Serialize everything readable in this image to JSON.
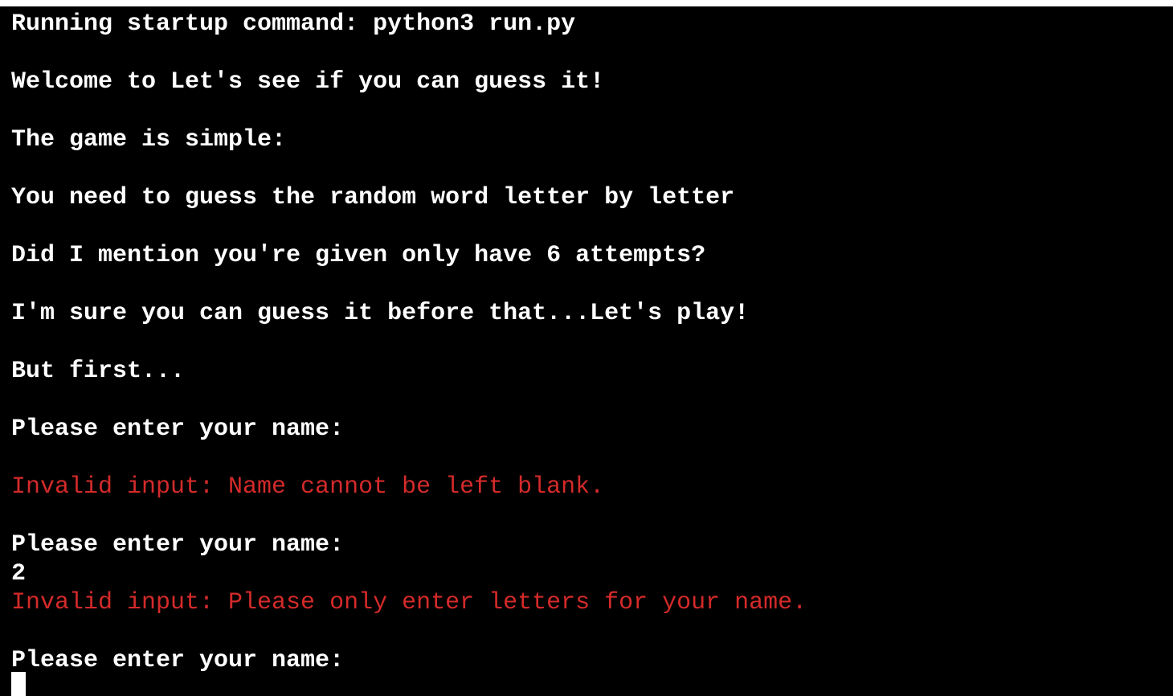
{
  "terminal": {
    "lines": {
      "startup": "Running startup command: python3 run.py",
      "welcome": "Welcome to Let's see if you can guess it!",
      "simple": "The game is simple:",
      "guess": "You need to guess the random word letter by letter",
      "attempts": "Did I mention you're given only have 6 attempts?",
      "sure": "I'm sure you can guess it before that...Let's play!",
      "first": "But first...",
      "prompt1": "Please enter your name:",
      "error1": "Invalid input: Name cannot be left blank.",
      "prompt2": "Please enter your name:",
      "input2": "2",
      "error2": "Invalid input: Please only enter letters for your name.",
      "prompt3": "Please enter your name:"
    },
    "colors": {
      "background": "#000000",
      "text": "#ffffff",
      "error": "#d42a2a"
    }
  }
}
